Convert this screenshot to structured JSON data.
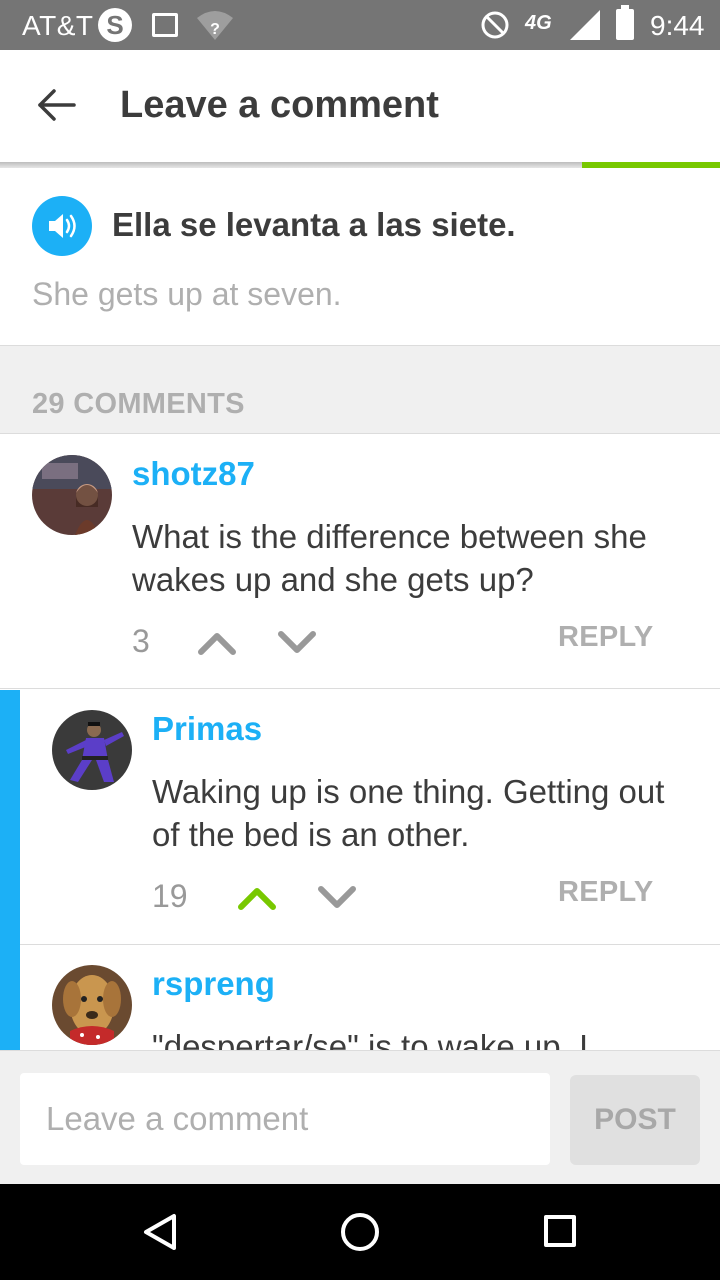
{
  "status_bar": {
    "carrier": "AT&T",
    "skype_glyph": "S",
    "lte_label": "4G",
    "time": "9:44"
  },
  "header": {
    "title": "Leave a comment"
  },
  "sentence": {
    "text": "Ella se levanta a las siete.",
    "translation": "She gets up at seven."
  },
  "comments_header": {
    "count_label": "29 COMMENTS"
  },
  "comments": [
    {
      "author": "shotz87",
      "body": "What is the difference between she wakes up and she gets up?",
      "votes": "3",
      "reply_label": "REPLY",
      "upvoted": false
    },
    {
      "author": "Primas",
      "body": "Waking up is one thing. Getting out of the bed is an other.",
      "votes": "19",
      "reply_label": "REPLY",
      "upvoted": true
    },
    {
      "author": "rspreng",
      "body": "\"despertar/se\" is to wake up. I"
    }
  ],
  "input_bar": {
    "placeholder": "Leave a comment",
    "post_label": "POST"
  },
  "colors": {
    "accent_blue": "#1cb0f6",
    "upvote_green": "#78c800",
    "text_dark": "#3c3c3c",
    "text_muted": "#afafaf"
  }
}
